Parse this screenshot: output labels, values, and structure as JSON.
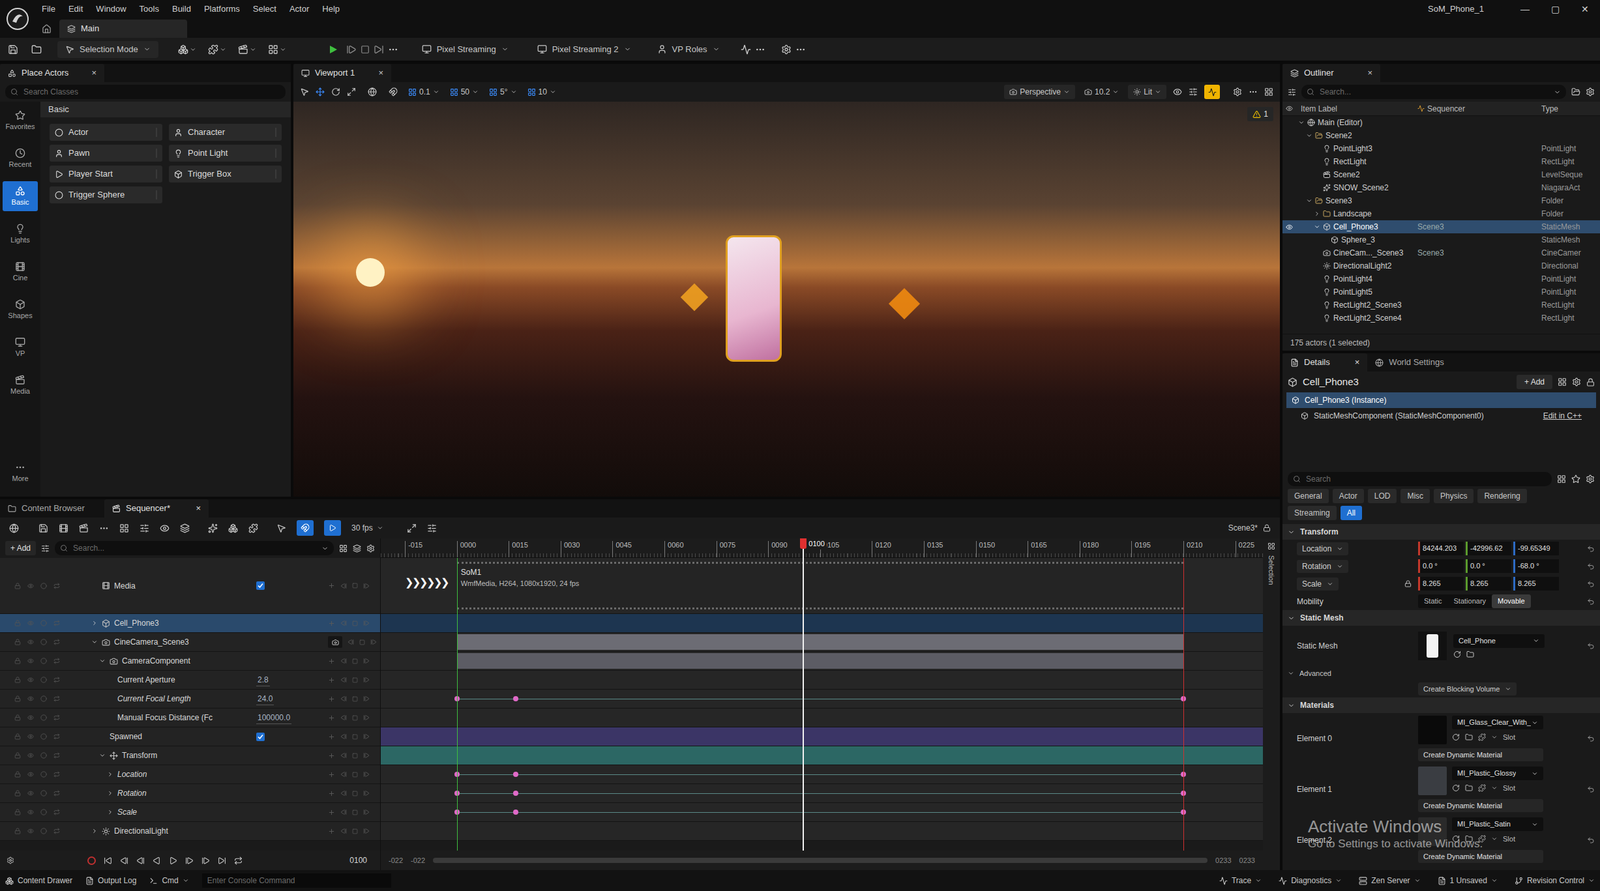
{
  "window": {
    "title": "SoM_Phone_1",
    "controls": [
      "—",
      "▢",
      "✕"
    ]
  },
  "menu": [
    "File",
    "Edit",
    "Window",
    "Tools",
    "Build",
    "Platforms",
    "Select",
    "Actor",
    "Help"
  ],
  "levelTab": {
    "label": "Main"
  },
  "toolbar": {
    "mode": "Selection Mode",
    "streaming": [
      "Pixel Streaming",
      "Pixel Streaming 2"
    ],
    "roles": "VP Roles"
  },
  "placeActors": {
    "title": "Place Actors",
    "close": "×",
    "search": "Search Classes",
    "category": "Basic",
    "sidebar": [
      {
        "label": "Favorites",
        "selected": false
      },
      {
        "label": "Recent",
        "selected": false
      },
      {
        "label": "Basic",
        "selected": true
      },
      {
        "label": "Lights",
        "selected": false
      },
      {
        "label": "Cine",
        "selected": false
      },
      {
        "label": "Shapes",
        "selected": false
      },
      {
        "label": "VP",
        "selected": false
      },
      {
        "label": "Media",
        "selected": false
      },
      {
        "label": "More",
        "selected": false
      }
    ],
    "items": [
      {
        "label": "Actor",
        "kind": "actor"
      },
      {
        "label": "Character",
        "kind": "character"
      },
      {
        "label": "Pawn",
        "kind": "pawn"
      },
      {
        "label": "Point Light",
        "kind": "light"
      },
      {
        "label": "Player Start",
        "kind": "start"
      },
      {
        "label": "Trigger Box",
        "kind": "box"
      },
      {
        "label": "Trigger Sphere",
        "kind": "sphere"
      }
    ]
  },
  "viewport": {
    "title": "Viewport 1",
    "close": "×",
    "snap": [
      "0.1",
      "50",
      "5°",
      "10"
    ],
    "view": "Perspective",
    "fov": "10.2",
    "lighting": "Lit",
    "warnings": "1"
  },
  "outliner": {
    "title": "Outliner",
    "close": "×",
    "search": "Search...",
    "columns": [
      "Item Label",
      "Sequencer",
      "Type"
    ],
    "count": "175 actors (1 selected)",
    "rows": [
      {
        "label": "Main (Editor)",
        "depth": 0,
        "kind": "level",
        "children": true,
        "expanded": true,
        "sequencer": "",
        "type": "",
        "selected": false
      },
      {
        "label": "Scene2",
        "depth": 1,
        "kind": "folder",
        "children": true,
        "expanded": true,
        "sequencer": "",
        "type": "",
        "selected": false
      },
      {
        "label": "PointLight3",
        "depth": 2,
        "kind": "light",
        "children": false,
        "expanded": false,
        "sequencer": "",
        "type": "PointLight",
        "selected": false
      },
      {
        "label": "RectLight",
        "depth": 2,
        "kind": "light",
        "children": false,
        "expanded": false,
        "sequencer": "",
        "type": "RectLight",
        "selected": false
      },
      {
        "label": "Scene2",
        "depth": 2,
        "kind": "sequence",
        "children": false,
        "expanded": false,
        "sequencer": "",
        "type": "LevelSeque",
        "selected": false
      },
      {
        "label": "SNOW_Scene2",
        "depth": 2,
        "kind": "niagara",
        "children": false,
        "expanded": false,
        "sequencer": "",
        "type": "NiagaraAct",
        "selected": false
      },
      {
        "label": "Scene3",
        "depth": 1,
        "kind": "folder",
        "children": true,
        "expanded": true,
        "sequencer": "",
        "type": "Folder",
        "selected": false
      },
      {
        "label": "Landscape",
        "depth": 2,
        "kind": "folder",
        "children": true,
        "expanded": false,
        "sequencer": "",
        "type": "Folder",
        "selected": false
      },
      {
        "label": "Cell_Phone3",
        "depth": 2,
        "kind": "mesh",
        "children": true,
        "expanded": true,
        "sequencer": "Scene3",
        "type": "StaticMesh",
        "selected": true
      },
      {
        "label": "Sphere_3",
        "depth": 3,
        "kind": "mesh",
        "children": false,
        "expanded": false,
        "sequencer": "",
        "type": "StaticMesh",
        "selected": false
      },
      {
        "label": "CineCam..._Scene3",
        "depth": 2,
        "kind": "camera",
        "children": false,
        "expanded": false,
        "sequencer": "Scene3",
        "type": "CineCamer",
        "selected": false
      },
      {
        "label": "DirectionalLight2",
        "depth": 2,
        "kind": "directional",
        "children": false,
        "expanded": false,
        "sequencer": "",
        "type": "Directional",
        "selected": false
      },
      {
        "label": "PointLight4",
        "depth": 2,
        "kind": "light",
        "children": false,
        "expanded": false,
        "sequencer": "",
        "type": "PointLight",
        "selected": false
      },
      {
        "label": "PointLight5",
        "depth": 2,
        "kind": "light",
        "children": false,
        "expanded": false,
        "sequencer": "",
        "type": "PointLight",
        "selected": false
      },
      {
        "label": "RectLight2_Scene3",
        "depth": 2,
        "kind": "light",
        "children": false,
        "expanded": false,
        "sequencer": "",
        "type": "RectLight",
        "selected": false
      },
      {
        "label": "RectLight2_Scene4",
        "depth": 2,
        "kind": "light",
        "children": false,
        "expanded": false,
        "sequencer": "",
        "type": "RectLight",
        "selected": false
      }
    ]
  },
  "details": {
    "tabs": [
      {
        "label": "Details",
        "selected": true
      },
      {
        "label": "World Settings",
        "selected": false
      }
    ],
    "close": "×",
    "actor": "Cell_Phone3",
    "add": "+ Add",
    "instance": "Cell_Phone3 (Instance)",
    "component": "StaticMeshComponent (StaticMeshComponent0)",
    "editLink": "Edit in C++",
    "search": "Search",
    "filters": [
      {
        "label": "General",
        "selected": false
      },
      {
        "label": "Actor",
        "selected": false
      },
      {
        "label": "LOD",
        "selected": false
      },
      {
        "label": "Misc",
        "selected": false
      },
      {
        "label": "Physics",
        "selected": false
      },
      {
        "label": "Rendering",
        "selected": false
      },
      {
        "label": "Streaming",
        "selected": false
      },
      {
        "label": "All",
        "selected": true
      }
    ],
    "transform": {
      "title": "Transform",
      "rows": [
        {
          "label": "Location",
          "values": [
            "84244.203",
            "-42996.62",
            "-99.65349"
          ],
          "locked": false
        },
        {
          "label": "Rotation",
          "values": [
            "0.0 °",
            "0.0 °",
            "-68.0 °"
          ],
          "locked": false
        },
        {
          "label": "Scale",
          "values": [
            "8.265",
            "8.265",
            "8.265"
          ],
          "locked": true
        }
      ],
      "mobility": {
        "label": "Mobility",
        "options": [
          {
            "label": "Static",
            "selected": false
          },
          {
            "label": "Stationary",
            "selected": false
          },
          {
            "label": "Movable",
            "selected": true
          }
        ]
      }
    },
    "staticMesh": {
      "title": "Static Mesh",
      "label": "Static Mesh",
      "value": "Cell_Phone",
      "advanced": "Advanced",
      "blocking": "Create Blocking Volume"
    },
    "materials": {
      "title": "Materials",
      "button": "Create Dynamic Material",
      "slot": "Slot",
      "elements": [
        {
          "label": "Element 0",
          "value": "MI_Glass_Clear_With_",
          "color": "#0a0a0a"
        },
        {
          "label": "Element 1",
          "value": "MI_Plastic_Glossy",
          "color": "#3a3d42"
        },
        {
          "label": "Element 2",
          "value": "MI_Plastic_Satin",
          "color": "#2a2a2a"
        }
      ]
    }
  },
  "sequencer": {
    "tabs": [
      {
        "label": "Content Browser",
        "selected": false
      },
      {
        "label": "Sequencer*",
        "selected": true
      }
    ],
    "close": "×",
    "fps": "30 fps",
    "sequence": "Scene3*",
    "add": "+ Add",
    "search": "Search...",
    "side": "Selection",
    "ticks": [
      "-015",
      "0000",
      "0015",
      "0030",
      "0045",
      "0060",
      "0075",
      "0090",
      "0105",
      "0120",
      "0135",
      "0150",
      "0165",
      "0180",
      "0195",
      "0210",
      "0225"
    ],
    "viewStart": "-022",
    "viewEnd": "0233",
    "playhead": "0100",
    "playRange": {
      "start": 0,
      "end": 210
    },
    "media": {
      "title": "SoM1",
      "info": "WmfMedia, H264, 1080x1920, 24 fps",
      "chevrons": "❯❯❯❯❯❯"
    },
    "tracks": [
      {
        "label": "Media",
        "depth": 0,
        "kind": "media",
        "children": false,
        "expanded": false,
        "selected": false,
        "checked": true,
        "value": "",
        "italic": false,
        "color": "#1c1c1c",
        "span": "none",
        "keys": []
      },
      {
        "label": "Cell_Phone3",
        "depth": 0,
        "kind": "mesh",
        "children": true,
        "expanded": false,
        "selected": true,
        "checked": false,
        "value": "",
        "italic": false,
        "color": "#1d3550",
        "span": "full",
        "keys": []
      },
      {
        "label": "CineCamera_Scene3",
        "depth": 0,
        "kind": "camera",
        "children": true,
        "expanded": true,
        "selected": false,
        "checked": false,
        "value": "",
        "italic": false,
        "color": "#6c6c74",
        "span": "range",
        "keys": []
      },
      {
        "label": "CameraComponent",
        "depth": 1,
        "kind": "component",
        "children": true,
        "expanded": true,
        "selected": false,
        "checked": false,
        "value": "",
        "italic": false,
        "color": "#5c5c64",
        "span": "range",
        "keys": []
      },
      {
        "label": "Current Aperture",
        "depth": 2,
        "kind": "property",
        "children": false,
        "expanded": false,
        "selected": false,
        "checked": false,
        "value": "2.8",
        "italic": false,
        "color": "#262626",
        "span": "none",
        "keys": []
      },
      {
        "label": "Current Focal Length",
        "depth": 2,
        "kind": "property",
        "children": false,
        "expanded": false,
        "selected": false,
        "checked": false,
        "value": "24.0",
        "italic": true,
        "color": "#262626",
        "span": "none",
        "keys": [
          0,
          17,
          210
        ]
      },
      {
        "label": "Manual Focus Distance (Fc",
        "depth": 2,
        "kind": "property",
        "children": false,
        "expanded": false,
        "selected": false,
        "checked": false,
        "value": "100000.0",
        "italic": false,
        "color": "#262626",
        "span": "none",
        "keys": []
      },
      {
        "label": "Spawned",
        "depth": 1,
        "kind": "bool",
        "children": false,
        "expanded": false,
        "selected": false,
        "checked": true,
        "value": "",
        "italic": false,
        "color": "#3b3566",
        "span": "full",
        "keys": []
      },
      {
        "label": "Transform",
        "depth": 1,
        "kind": "group",
        "children": true,
        "expanded": true,
        "selected": false,
        "checked": false,
        "value": "",
        "italic": false,
        "color": "#2c6764",
        "span": "full",
        "keys": []
      },
      {
        "label": "Location",
        "depth": 2,
        "kind": "channel",
        "children": true,
        "expanded": false,
        "selected": false,
        "checked": false,
        "value": "",
        "italic": true,
        "color": "#262626",
        "span": "none",
        "keys": [
          0,
          17,
          210
        ]
      },
      {
        "label": "Rotation",
        "depth": 2,
        "kind": "channel",
        "children": true,
        "expanded": false,
        "selected": false,
        "checked": false,
        "value": "",
        "italic": true,
        "color": "#262626",
        "span": "none",
        "keys": [
          0,
          17,
          210
        ]
      },
      {
        "label": "Scale",
        "depth": 2,
        "kind": "channel",
        "children": true,
        "expanded": false,
        "selected": false,
        "checked": false,
        "value": "",
        "italic": true,
        "color": "#262626",
        "span": "none",
        "keys": [
          0,
          17,
          210
        ]
      },
      {
        "label": "DirectionalLight",
        "depth": 0,
        "kind": "directional",
        "children": true,
        "expanded": false,
        "selected": false,
        "checked": false,
        "value": "",
        "italic": false,
        "color": "#242424",
        "span": "none",
        "keys": []
      }
    ]
  },
  "statusBar": {
    "left": [
      "Content Drawer",
      "Output Log",
      "Cmd"
    ],
    "console": "Enter Console Command",
    "right": [
      "Trace",
      "Diagnostics",
      "Zen Server",
      "1 Unsaved",
      "Revision Control"
    ]
  },
  "watermark": [
    "Activate Windows",
    "Go to Settings to activate Windows."
  ]
}
